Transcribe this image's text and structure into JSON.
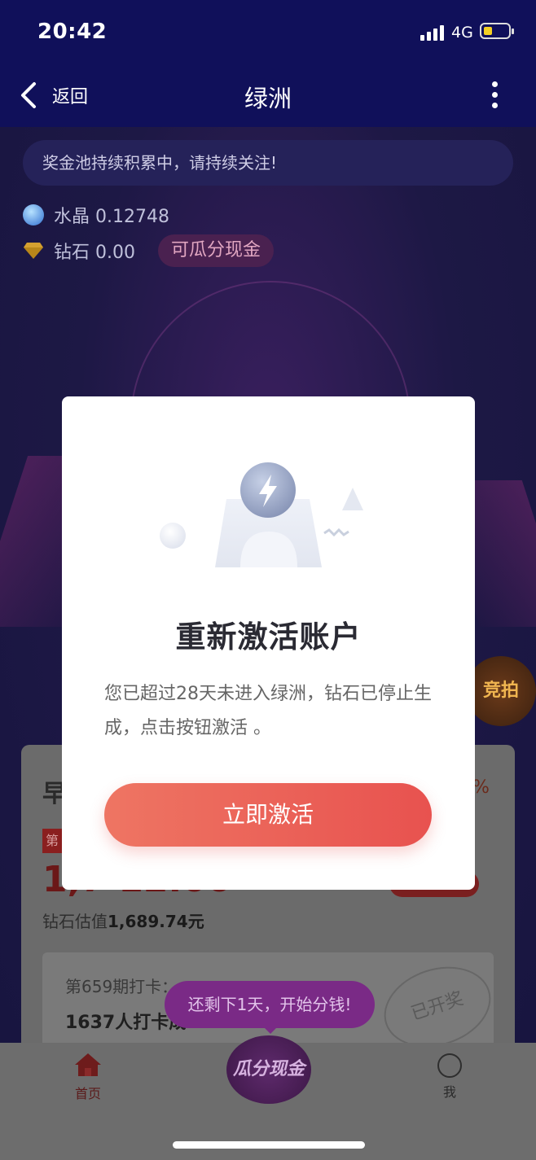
{
  "status_bar": {
    "time": "20:42",
    "network": "4G"
  },
  "nav": {
    "back_label": "返回",
    "title": "绿洲"
  },
  "page": {
    "notice": "奖金池持续积累中，请持续关注!",
    "crystal": {
      "label": "水晶 0.12748"
    },
    "diamond": {
      "label": "钻石 0.00",
      "cash_chip": "可瓜分现金"
    },
    "auction_badge": "竞拍",
    "card": {
      "title": "早",
      "percent": "%",
      "tag": "第",
      "big_number": "1,7 12.00",
      "estimate_label": "钻石估值",
      "estimate_value": "1,689.74元",
      "checkin_issue": "第659期打卡：",
      "checkin_count": "1637人打卡成",
      "stamp": "已开奖"
    },
    "toast": "还剩下1天，开始分钱!"
  },
  "tab_bar": {
    "home_label": "首页",
    "cash_label": "瓜分现金",
    "me_label": "我"
  },
  "modal": {
    "title": "重新激活账户",
    "description": "您已超过28天未进入绿洲，钻石已停止生成，点击按钮激活 。",
    "button_label": "立即激活"
  }
}
